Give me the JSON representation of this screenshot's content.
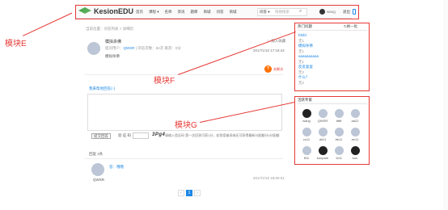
{
  "annotations": {
    "e": "模块E",
    "f": "模块F",
    "g": "模块G"
  },
  "navbar": {
    "logo": "KesionEDU",
    "items": [
      "首页",
      "课程 ▾",
      "名师",
      "资讯",
      "题库",
      "商城",
      "问答",
      "商城"
    ],
    "search_label": "问答 ▾",
    "search_placeholder": "快搜搜索",
    "user": "wang",
    "logout": "退出"
  },
  "breadcrumb": "当前位置：问答列表 > 详细页",
  "question": {
    "title": "模拟杀佛",
    "meta_prefix": "提问用户：",
    "user": "QWSR",
    "meta_suffix": " | 浏览次数：82次 悬赏：0分",
    "body": "模拟杀佛",
    "fav": "☆ 加入收藏",
    "time": "2017/1/10 17:18:44",
    "solve_badge": "?",
    "solve_text": "未解决"
  },
  "answer_link": "我来帮他回答(↑)",
  "submit_button": "提交回答",
  "captcha": {
    "label": "验 证 码",
    "code": "3Pg4"
  },
  "note": "请输入验证码 第一次回答可获1分，若答案被采纳还可获得最新分配额分0分配额",
  "reply_count": "回复 2条",
  "reply": {
    "user": "QWSR",
    "text": "答：哦哦",
    "time": "2017/1/10 18:00:01"
  },
  "pager": {
    "prev": "‹",
    "current": "1",
    "next": "›"
  },
  "hot": {
    "title": "热门问题",
    "refresh": "↻换一批",
    "items": [
      {
        "q": "fdsfd",
        "c": "无1"
      },
      {
        "q": "模拟杀佛",
        "c": "无1"
      },
      {
        "q": "aaaaaaaaaa",
        "c": "无1"
      },
      {
        "q": "反反复复",
        "c": "无2"
      },
      {
        "q": "什么？",
        "c": "无2"
      }
    ]
  },
  "experts": {
    "title": "活跃专家",
    "names": [
      "wang",
      "QWSR",
      "tttttt",
      "aa22",
      "cc11",
      "dd11",
      "bb11",
      "ee11",
      "ff11",
      "kunpam",
      "1111",
      "kun"
    ]
  }
}
